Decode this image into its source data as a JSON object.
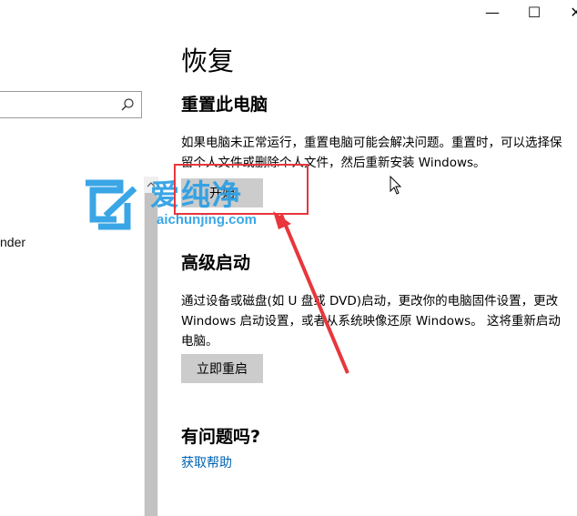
{
  "window": {
    "minimize_glyph": "—",
    "maximize_glyph": "☐",
    "close_glyph": "✕"
  },
  "sidebar": {
    "search_placeholder": "",
    "nav_item_partial": "nder",
    "scroll_up_glyph": "⌃"
  },
  "main": {
    "title": "恢复",
    "reset": {
      "heading": "重置此电脑",
      "description": "如果电脑未正常运行，重置电脑可能会解决问题。重置时，可以选择保留个人文件或删除个人文件，然后重新安装 Windows。",
      "button": "开始"
    },
    "advanced": {
      "heading": "高级启动",
      "description": "通过设备或磁盘(如 U 盘或 DVD)启动，更改你的电脑固件设置，更改 Windows 启动设置，或者从系统映像还原 Windows。 这将重新启动电脑。",
      "button": "立即重启"
    },
    "help": {
      "heading": "有问题吗?",
      "link": "获取帮助"
    }
  },
  "watermark": {
    "text": "爱纯净",
    "url": "aichunjing.com"
  },
  "colors": {
    "accent_link": "#0063b1",
    "button_bg": "#cccccc",
    "annotation_red": "#e8363c",
    "watermark_blue": "#2a9fe4"
  }
}
